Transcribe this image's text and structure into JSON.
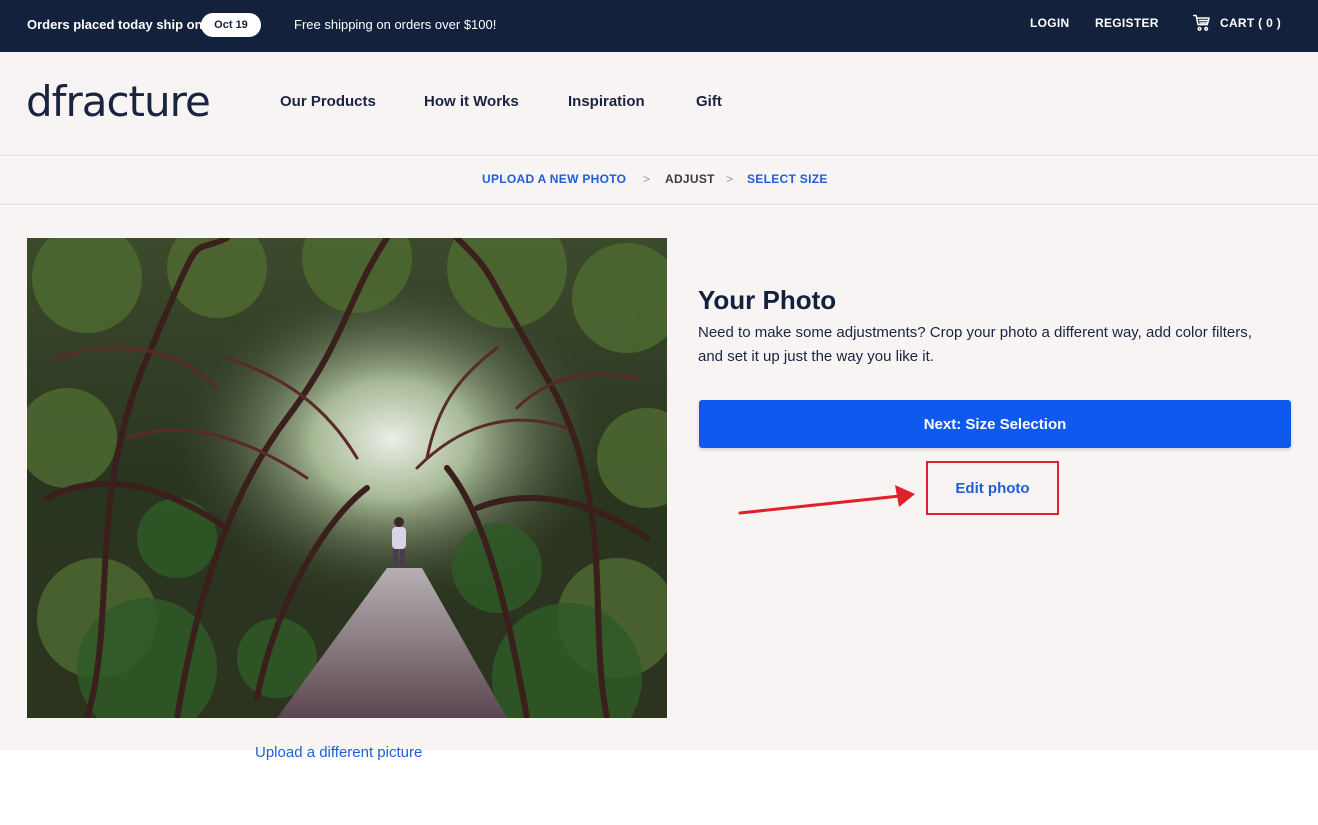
{
  "topbar": {
    "ship_text": "Orders placed today ship on",
    "ship_date": "Oct 19",
    "free_shipping": "Free shipping on orders over $100!",
    "login": "LOGIN",
    "register": "REGISTER",
    "cart": "CART ( 0 )"
  },
  "header": {
    "logo": "dfracture",
    "nav": [
      "Our Products",
      "How it Works",
      "Inspiration",
      "Gift"
    ]
  },
  "breadcrumb": {
    "upload": "UPLOAD A NEW PHOTO",
    "sep": ">",
    "adjust": "ADJUST",
    "size": "SELECT SIZE"
  },
  "main": {
    "title": "Your Photo",
    "description": "Need to make some adjustments? Crop your photo a different way, add color filters, and set it up just the way you like it.",
    "next_button": "Next: Size Selection",
    "edit_link": "Edit photo",
    "upload_link": "Upload a different picture"
  },
  "colors": {
    "accent": "#1059ef",
    "topbar": "#14213d",
    "annotation": "#e0202a"
  }
}
